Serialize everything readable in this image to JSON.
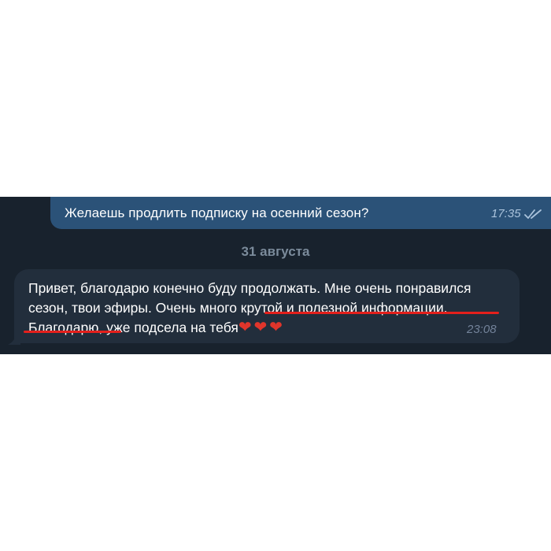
{
  "outgoing_message": {
    "text": "Желаешь продлить подписку на осенний сезон?",
    "time": "17:35",
    "status_icon": "double-check-icon"
  },
  "date_separator": "31 августа",
  "incoming_message": {
    "text_part1": "Привет, благодарю конечно буду продолжать. Мне очень понравился сезон, твои эфиры. ",
    "text_part2": "Очень много крутой и полезной информации",
    "text_part3": ". Благодарю, уже подсела на тебя",
    "hearts": [
      "❤",
      "❤",
      "❤"
    ],
    "time": "23:08"
  },
  "colors": {
    "chat_background": "#18222d",
    "outgoing_bubble": "#2b5278",
    "incoming_bubble": "#222e3c",
    "underline_highlight": "#e4201c",
    "heart": "#e0352b"
  }
}
